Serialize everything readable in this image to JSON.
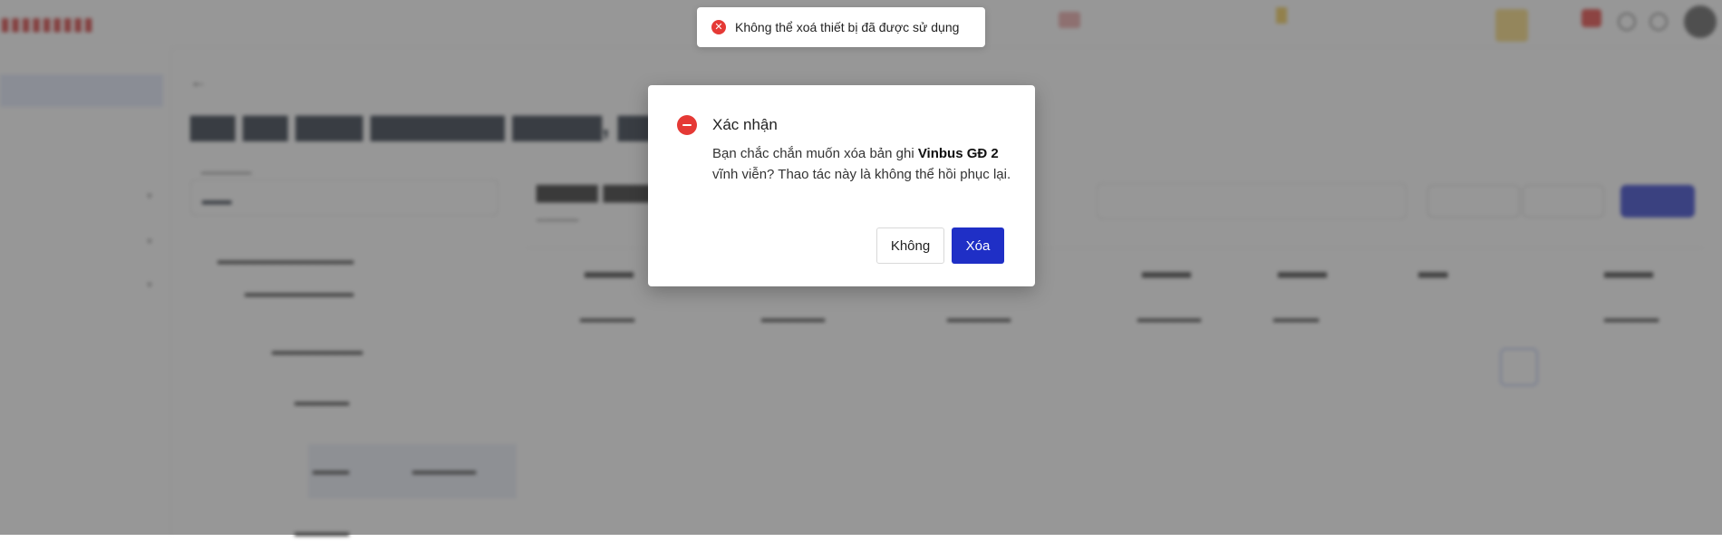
{
  "toast": {
    "message": "Không thể xoá thiết bị đã được sử dụng",
    "icon": "close-circle-icon",
    "color": "#e53935"
  },
  "dialog": {
    "title": "Xác nhận",
    "body_before": "Bạn chắc chắn muốn xóa bản ghi ",
    "record_name": "Vinbus GĐ 2",
    "body_after": " vĩnh viễn? Thao tác này là không thể hồi phục lại.",
    "cancel_label": "Không",
    "confirm_label": "Xóa",
    "icon": "minus-circle-icon",
    "confirm_color": "#1f2fc6",
    "icon_color": "#e53935"
  },
  "overlay_color": "rgba(75,75,75,0.58)"
}
